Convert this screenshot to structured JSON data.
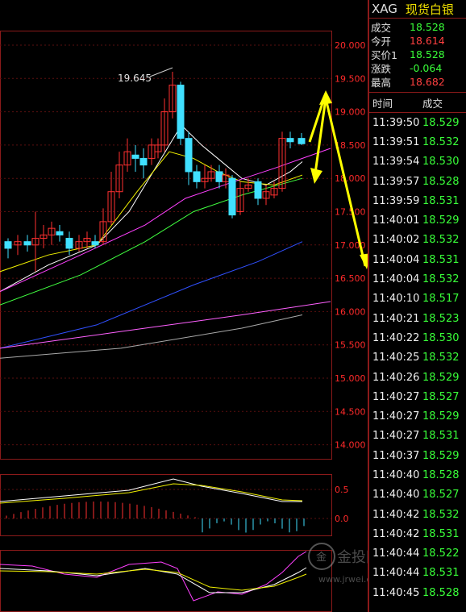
{
  "symbol": {
    "code": "XAG",
    "name": "现货白银"
  },
  "quote": [
    {
      "label": "成交",
      "value": "18.528",
      "color": "#39ff39"
    },
    {
      "label": "今开",
      "value": "18.614",
      "color": "#ff4040"
    },
    {
      "label": "买价1",
      "value": "18.528",
      "color": "#39ff39"
    },
    {
      "label": "涨跌",
      "value": "-0.064",
      "color": "#39ff39"
    },
    {
      "label": "最高",
      "value": "18.682",
      "color": "#ff4040"
    }
  ],
  "ticks_header": {
    "time": "时间",
    "trade": "成交"
  },
  "ticks": [
    {
      "time": "11:39:50",
      "price": "18.529"
    },
    {
      "time": "11:39:51",
      "price": "18.532"
    },
    {
      "time": "11:39:54",
      "price": "18.530"
    },
    {
      "time": "11:39:57",
      "price": "18.528"
    },
    {
      "time": "11:39:59",
      "price": "18.531"
    },
    {
      "time": "11:40:01",
      "price": "18.529"
    },
    {
      "time": "11:40:02",
      "price": "18.532"
    },
    {
      "time": "11:40:04",
      "price": "18.531"
    },
    {
      "time": "11:40:04",
      "price": "18.532"
    },
    {
      "time": "11:40:10",
      "price": "18.517"
    },
    {
      "time": "11:40:21",
      "price": "18.523"
    },
    {
      "time": "11:40:22",
      "price": "18.530"
    },
    {
      "time": "11:40:25",
      "price": "18.532"
    },
    {
      "time": "11:40:26",
      "price": "18.529"
    },
    {
      "time": "11:40:27",
      "price": "18.527"
    },
    {
      "time": "11:40:27",
      "price": "18.529"
    },
    {
      "time": "11:40:27",
      "price": "18.531"
    },
    {
      "time": "11:40:37",
      "price": "18.529"
    },
    {
      "time": "11:40:40",
      "price": "18.528"
    },
    {
      "time": "11:40:40",
      "price": "18.527"
    },
    {
      "time": "11:40:42",
      "price": "18.532"
    },
    {
      "time": "11:40:42",
      "price": "18.531"
    },
    {
      "time": "11:40:44",
      "price": "18.522"
    },
    {
      "time": "11:40:44",
      "price": "18.531"
    },
    {
      "time": "11:40:45",
      "price": "18.528"
    }
  ],
  "chart_data": {
    "type": "candlestick",
    "y_axis_main": [
      "20.000",
      "19.500",
      "19.000",
      "18.500",
      "18.000",
      "17.500",
      "17.000",
      "16.500",
      "16.000",
      "15.500",
      "15.000",
      "14.500",
      "14.000"
    ],
    "y_axis_macd": [
      "0.5",
      "0.0"
    ],
    "high_label": "19.645",
    "colors": {
      "up": "#ff3030",
      "down": "#40e0ff",
      "axis": "#ff2a2a"
    }
  },
  "watermark": {
    "brand": "金投网",
    "url": "www.jrwei.com"
  }
}
